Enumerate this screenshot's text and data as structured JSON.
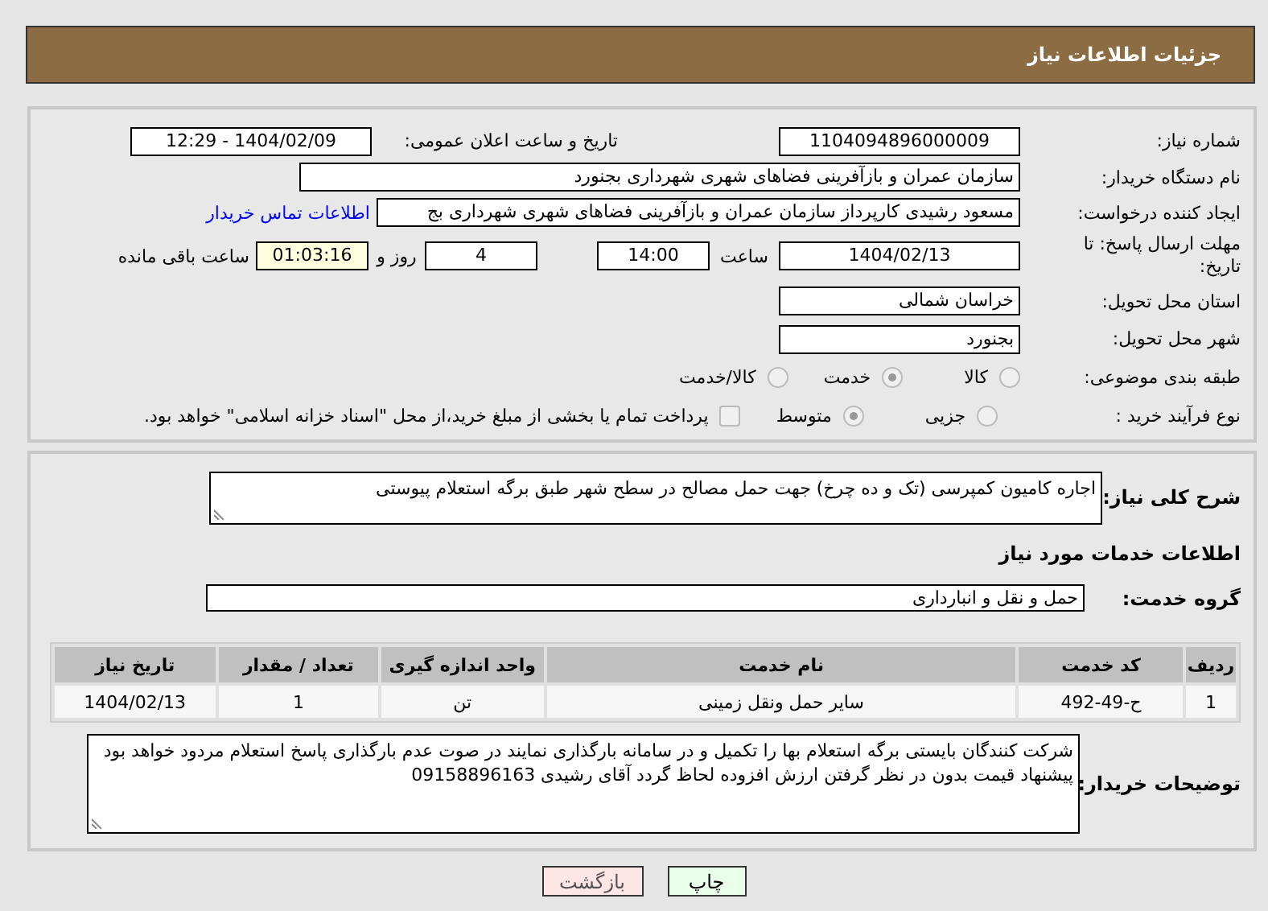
{
  "header": {
    "title": "جزئیات اطلاعات نیاز"
  },
  "need_info": {
    "need_number": {
      "label": "شماره نیاز:",
      "value": "1104094896000009"
    },
    "announce_datetime": {
      "label": "تاریخ و ساعت اعلان عمومی:",
      "value": "1404/02/09 - 12:29"
    },
    "buyer_org": {
      "label": "نام دستگاه خریدار:",
      "value": "سازمان عمران و بازآفرینی فضاهای شهری شهرداری بجنورد"
    },
    "requester": {
      "label": "ایجاد کننده درخواست:",
      "value": "مسعود رشیدی کارپرداز سازمان عمران و بازآفرینی فضاهای شهری شهرداری بج",
      "link": "اطلاعات تماس خریدار"
    },
    "deadline": {
      "label": "مهلت ارسال پاسخ: تا تاریخ:",
      "date": "1404/02/13",
      "time_label": "ساعت",
      "time": "14:00",
      "days": "4",
      "days_label": "روز و",
      "remaining": "01:03:16",
      "remaining_label": "ساعت باقی مانده"
    },
    "province": {
      "label": "استان محل تحویل:",
      "value": "خراسان شمالی"
    },
    "city": {
      "label": "شهر محل تحویل:",
      "value": "بجنورد"
    },
    "category": {
      "label": "طبقه بندی موضوعی:",
      "options": [
        {
          "label": "کالا",
          "selected": false
        },
        {
          "label": "خدمت",
          "selected": true
        },
        {
          "label": "کالا/خدمت",
          "selected": false
        }
      ]
    },
    "purchase_type": {
      "label": "نوع فرآیند خرید :",
      "options": [
        {
          "label": "جزیی",
          "selected": false
        },
        {
          "label": "متوسط",
          "selected": true
        }
      ],
      "payment": {
        "checked": false,
        "label": "پرداخت تمام یا بخشی از مبلغ خرید،از محل \"اسناد خزانه اسلامی\" خواهد بود."
      }
    }
  },
  "services": {
    "description": {
      "label": "شرح کلی نیاز:",
      "value": "اجاره کامیون کمپرسی (تک و ده چرخ) جهت حمل مصالح در سطح شهر طبق برگه استعلام پیوستی"
    },
    "heading": "اطلاعات خدمات مورد نیاز",
    "service_group": {
      "label": "گروه خدمت:",
      "value": "حمل و نقل و انبارداری"
    },
    "table": {
      "columns": [
        "ردیف",
        "کد خدمت",
        "نام خدمت",
        "واحد اندازه گیری",
        "تعداد / مقدار",
        "تاریخ نیاز"
      ],
      "rows": [
        [
          "1",
          "ح-49-492",
          "سایر حمل ونقل زمینی",
          "تن",
          "1",
          "1404/02/13"
        ]
      ]
    },
    "buyer_notes": {
      "label": "توضیحات خریدار:",
      "value": "شرکت کنندگان بایستی برگه استعلام بها را تکمیل و در سامانه بارگذاری نمایند در صوت عدم بارگذاری پاسخ استعلام مردود خواهد بود پیشنهاد قیمت بدون در نظر گرفتن ارزش افزوده لحاظ گردد آقای رشیدی 09158896163"
    }
  },
  "buttons": [
    {
      "label": "چاپ",
      "kind": "print"
    },
    {
      "label": "بازگشت",
      "kind": "back"
    }
  ]
}
